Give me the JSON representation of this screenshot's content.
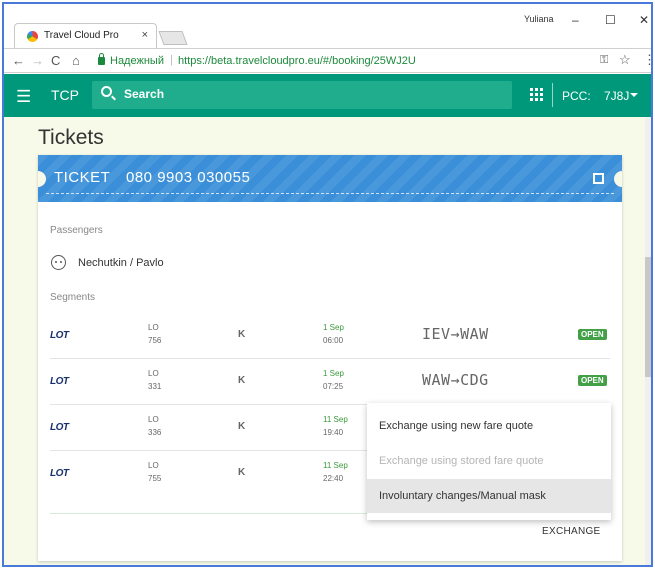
{
  "browser": {
    "tab_title": "Travel Cloud Pro",
    "tab_close": "×",
    "user_name": "Yuliana",
    "win_min": "–",
    "win_max": "☐",
    "win_close": "✕",
    "nav": {
      "back": "←",
      "forward": "→",
      "reload": "C",
      "home": "⌂"
    },
    "secure_label": "Надежный",
    "url": "https://beta.travelcloudpro.eu/#/booking/25WJ2U",
    "icons": {
      "key": "key-icon",
      "star": "star-icon",
      "menu": "menu-dots-icon"
    }
  },
  "app": {
    "title": "TCP",
    "search_placeholder": "Search",
    "pcc_label": "PCC:",
    "pcc_value": "7J8J",
    "accent": "#00987a"
  },
  "page": {
    "title": "Tickets",
    "background": "#f7f9e9"
  },
  "ticket": {
    "label": "TICKET",
    "number": "080 9903 030055",
    "header_color": "#3a8fd8",
    "passengers_label": "Passengers",
    "passenger": "Nechutkin / Pavlo",
    "segments_label": "Segments",
    "segments": [
      {
        "airline": "LOT",
        "carrier": "LO",
        "flight": "756",
        "class": "K",
        "date": "1 Sep",
        "time": "06:00",
        "route": "IEV→WAW",
        "status": "OPEN"
      },
      {
        "airline": "LOT",
        "carrier": "LO",
        "flight": "331",
        "class": "K",
        "date": "1 Sep",
        "time": "07:25",
        "route": "WAW→CDG",
        "status": "OPEN"
      },
      {
        "airline": "LOT",
        "carrier": "LO",
        "flight": "336",
        "class": "K",
        "date": "11 Sep",
        "time": "19:40",
        "route": "",
        "status": ""
      },
      {
        "airline": "LOT",
        "carrier": "LO",
        "flight": "755",
        "class": "K",
        "date": "11 Sep",
        "time": "22:40",
        "route": "",
        "status": ""
      }
    ],
    "exchange_button": "EXCHANGE",
    "status_color": "#43a047"
  },
  "exchange_menu": {
    "items": [
      {
        "label": "Exchange using new fare quote",
        "state": "enabled"
      },
      {
        "label": "Exchange using stored fare quote",
        "state": "disabled"
      },
      {
        "label": "Involuntary changes/Manual mask",
        "state": "highlighted"
      }
    ]
  }
}
